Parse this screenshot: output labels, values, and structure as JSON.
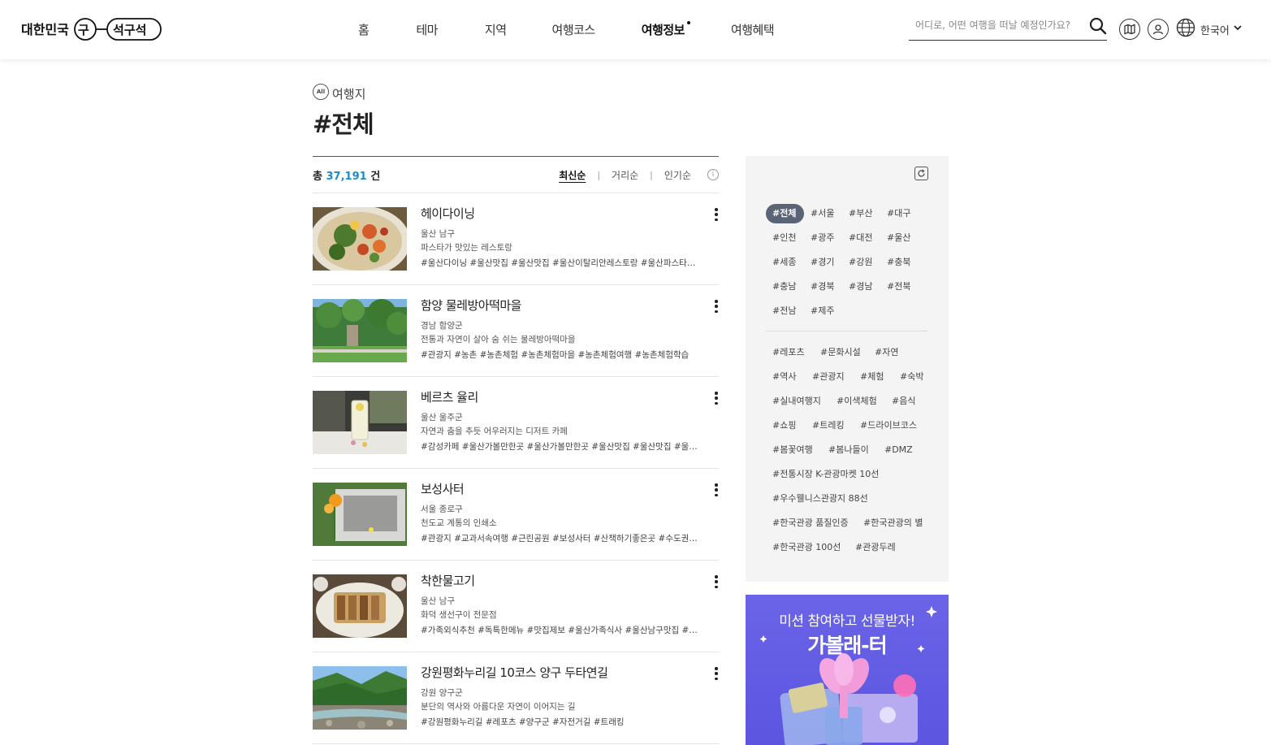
{
  "header": {
    "logo_text": "대한민국 구석구석",
    "nav": [
      "홈",
      "테마",
      "지역",
      "여행코스",
      "여행정보",
      "여행혜택"
    ],
    "active_nav": "여행정보",
    "search_placeholder": "어디로, 어떤 여행을 떠날 예정인가요?",
    "language": "한국어"
  },
  "page": {
    "badge": "All",
    "category": "여행지",
    "title": "#전체"
  },
  "list": {
    "total_prefix": "총",
    "total_count": "37,191",
    "total_suffix": "건",
    "sorts": [
      "최신순",
      "거리순",
      "인기순"
    ],
    "active_sort": "최신순",
    "items": [
      {
        "name": "헤이다이닝",
        "area": "울산 남구",
        "desc": "파스타가 맛있는 레스토랑",
        "tags": "#울산다이닝 #울산맛집 #울산맛집 #울산이탈리안레스토랑 #울산파스타맛집"
      },
      {
        "name": "함양 물레방아떡마을",
        "area": "경남 함양군",
        "desc": "전통과 자연이 살아 숨 쉬는 물레방아떡마을",
        "tags": "#관광지 #농촌 #농촌체험 #농촌체험마을 #농촌체험여행 #농촌체험학습"
      },
      {
        "name": "베르츠 율리",
        "area": "울산 울주군",
        "desc": "자연과 춤을 추듯 어우러지는 디저트 카페",
        "tags": "#감성카페 #울산가볼만한곳 #울산가볼만한곳 #울산맛집 #울산맛집 #울산카페"
      },
      {
        "name": "보성사터",
        "area": "서울 종로구",
        "desc": "천도교 계통의 인쇄소",
        "tags": "#관광지 #교과서속여행 #근린공원 #보성사터 #산책하기좋은곳 #수도권여행"
      },
      {
        "name": "착한물고기",
        "area": "울산 남구",
        "desc": "화덕 생선구이 전문점",
        "tags": "#가족외식추천 #독특한메뉴 #맛집제보 #울산가족식사 #울산남구맛집 #울산맛집"
      },
      {
        "name": "강원평화누리길 10코스 양구 두타연길",
        "area": "강원 양구군",
        "desc": "분단의 역사와 아름다운 자연이 이어지는 길",
        "tags": "#강원평화누리길 #레포츠 #양구군 #자전거길 #트래킹"
      }
    ]
  },
  "filter": {
    "regions": [
      "#전체",
      "#서울",
      "#부산",
      "#대구",
      "#인천",
      "#광주",
      "#대전",
      "#울산",
      "#세종",
      "#경기",
      "#강원",
      "#충북",
      "#충남",
      "#경북",
      "#경남",
      "#전북",
      "#전남",
      "#제주"
    ],
    "active_region": "#전체",
    "themes": [
      "#레포츠",
      "#문화시설",
      "#자연",
      "#역사",
      "#관광지",
      "#체험",
      "#숙박",
      "#실내여행지",
      "#이색체험",
      "#음식",
      "#쇼핑",
      "#트레킹",
      "#드라이브코스",
      "#봄꽃여행",
      "#봄나들이",
      "#DMZ",
      "#전통시장 K-관광마켓 10선",
      "#우수웰니스관광지 88선",
      "#한국관광 품질인증",
      "#한국관광의 별",
      "#한국관광 100선",
      "#관광두레"
    ]
  },
  "banner": {
    "line1": "미션 참여하고 선물받자!",
    "line2": "가볼래-터"
  },
  "colors": {
    "count_accent": "#1c8bc6",
    "active_tag_bg": "#5b6377",
    "banner_bg": "#6b64e8"
  }
}
